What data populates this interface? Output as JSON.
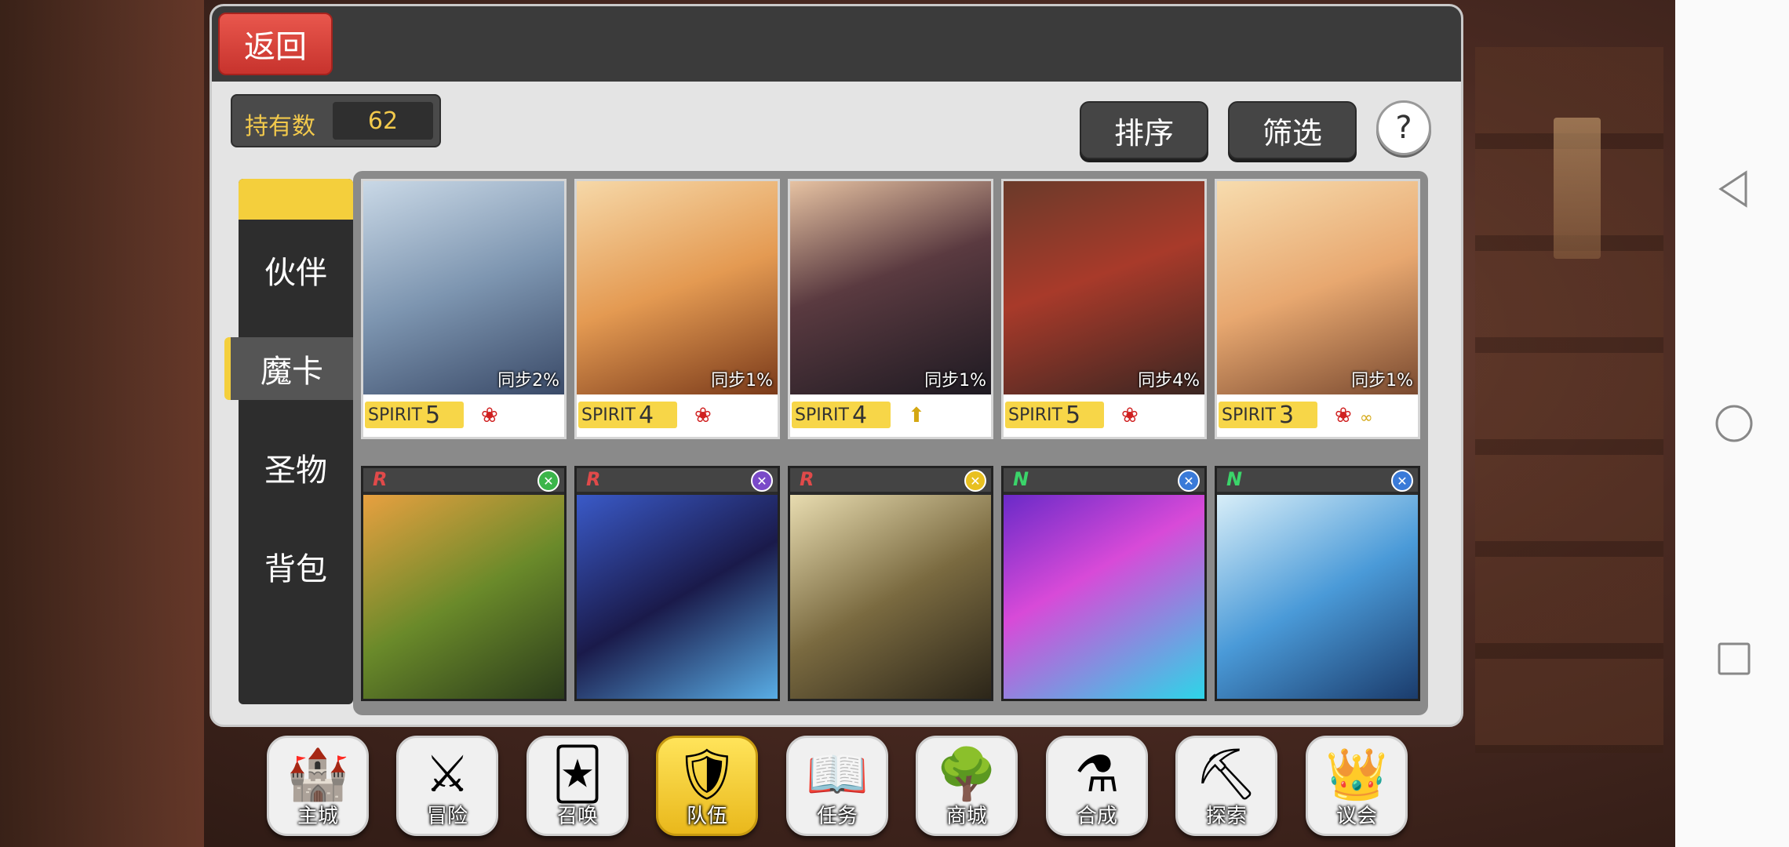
{
  "header": {
    "back_label": "返回"
  },
  "holding": {
    "label": "持有数",
    "value": "62"
  },
  "toolbar": {
    "sort_label": "排序",
    "filter_label": "筛选",
    "help_label": "?"
  },
  "tabs": [
    "伙伴",
    "魔卡",
    "圣物",
    "背包"
  ],
  "active_tab": "魔卡",
  "magic_cards": [
    {
      "sync": "同步2%",
      "spirit_text": "SPIRIT",
      "spirit_level": "5",
      "element": "fire"
    },
    {
      "sync": "同步1%",
      "spirit_text": "SPIRIT",
      "spirit_level": "4",
      "element": "fire"
    },
    {
      "sync": "同步1%",
      "spirit_text": "SPIRIT",
      "spirit_level": "4",
      "element": "arrow-up"
    },
    {
      "sync": "同步4%",
      "spirit_text": "SPIRIT",
      "spirit_level": "5",
      "element": "fire"
    },
    {
      "sync": "同步1%",
      "spirit_text": "SPIRIT",
      "spirit_level": "3",
      "element": "fire+gold"
    }
  ],
  "companion_cards": [
    {
      "rarity": "R",
      "badge": "green"
    },
    {
      "rarity": "R",
      "badge": "purple"
    },
    {
      "rarity": "R",
      "badge": "yellow"
    },
    {
      "rarity": "N",
      "badge": "blue"
    },
    {
      "rarity": "N",
      "badge": "blue"
    }
  ],
  "bottom_nav": [
    "主城",
    "冒险",
    "召唤",
    "队伍",
    "任务",
    "商城",
    "合成",
    "探索",
    "议会"
  ],
  "bottom_nav_active": "队伍",
  "colors": {
    "accent": "#f4cf3c",
    "back_button": "#d9433b"
  }
}
